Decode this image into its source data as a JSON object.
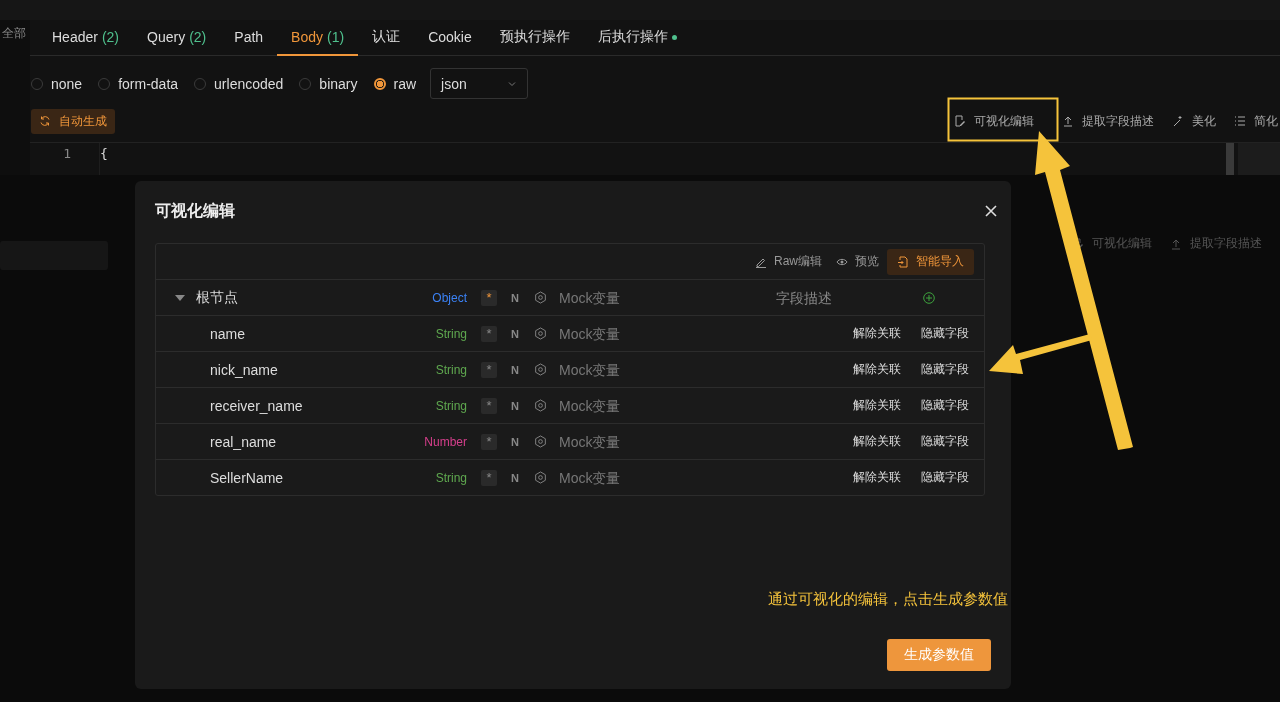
{
  "sidebar": {
    "filter_label": "全部"
  },
  "tabs": [
    {
      "label": "Header",
      "count": "(2)",
      "selected": false,
      "dot": false
    },
    {
      "label": "Query",
      "count": "(2)",
      "selected": false,
      "dot": false
    },
    {
      "label": "Path",
      "selected": false,
      "dot": false
    },
    {
      "label": "Body",
      "count": "(1)",
      "selected": true,
      "dot": false
    },
    {
      "label": "认证",
      "selected": false,
      "dot": false
    },
    {
      "label": "Cookie",
      "selected": false,
      "dot": false
    },
    {
      "label": "预执行操作",
      "selected": false,
      "dot": false
    },
    {
      "label": "后执行操作",
      "selected": false,
      "dot": true
    }
  ],
  "body_types": [
    {
      "label": "none",
      "selected": false
    },
    {
      "label": "form-data",
      "selected": false
    },
    {
      "label": "urlencoded",
      "selected": false
    },
    {
      "label": "binary",
      "selected": false
    },
    {
      "label": "raw",
      "selected": true
    }
  ],
  "format_select": {
    "value": "json"
  },
  "auto_generate_button": "自动生成",
  "editor_tools": [
    {
      "label": "可视化编辑",
      "kind": "edit",
      "highlighted": true
    },
    {
      "label": "提取字段描述",
      "kind": "upload",
      "highlighted": false
    },
    {
      "label": "美化",
      "kind": "wand",
      "highlighted": false
    },
    {
      "label": "简化",
      "kind": "list",
      "highlighted": false
    }
  ],
  "editor": {
    "lines": [
      {
        "number": "1",
        "code": "{"
      }
    ]
  },
  "background_tools": [
    {
      "label": "可视化编辑",
      "kind": "edit"
    },
    {
      "label": "提取字段描述",
      "kind": "upload"
    }
  ],
  "dialog": {
    "title": "可视化编辑",
    "toolbar": [
      {
        "label": "Raw编辑",
        "kind": "edit",
        "primary": false
      },
      {
        "label": "预览",
        "kind": "preview",
        "primary": false
      },
      {
        "label": "智能导入",
        "kind": "import",
        "primary": true
      }
    ],
    "root": {
      "name": "根节点",
      "type": "Object",
      "color": "#3b82f6",
      "expanded": true,
      "required": true,
      "required_label": "*",
      "null_label": "N",
      "mock_placeholder": "Mock变量",
      "description_placeholder": "字段描述",
      "children": [
        {
          "name": "name",
          "type": "String",
          "color": "#5fa84f",
          "required": false,
          "null_label": "N",
          "mock_placeholder": "Mock变量",
          "actions": [
            "解除关联",
            "隐藏字段"
          ]
        },
        {
          "name": "nick_name",
          "type": "String",
          "color": "#5fa84f",
          "required": false,
          "null_label": "N",
          "mock_placeholder": "Mock变量",
          "actions": [
            "解除关联",
            "隐藏字段"
          ]
        },
        {
          "name": "receiver_name",
          "type": "String",
          "color": "#5fa84f",
          "required": false,
          "null_label": "N",
          "mock_placeholder": "Mock变量",
          "actions": [
            "解除关联",
            "隐藏字段"
          ]
        },
        {
          "name": "real_name",
          "type": "Number",
          "color": "#d63f8c",
          "required": false,
          "null_label": "N",
          "mock_placeholder": "Mock变量",
          "actions": [
            "解除关联",
            "隐藏字段"
          ]
        },
        {
          "name": "SellerName",
          "type": "String",
          "color": "#5fa84f",
          "required": false,
          "null_label": "N",
          "mock_placeholder": "Mock变量",
          "actions": [
            "解除关联",
            "隐藏字段"
          ]
        }
      ]
    },
    "annotation": "通过可视化的编辑，点击生成参数值",
    "submit_button": "生成参数值"
  }
}
